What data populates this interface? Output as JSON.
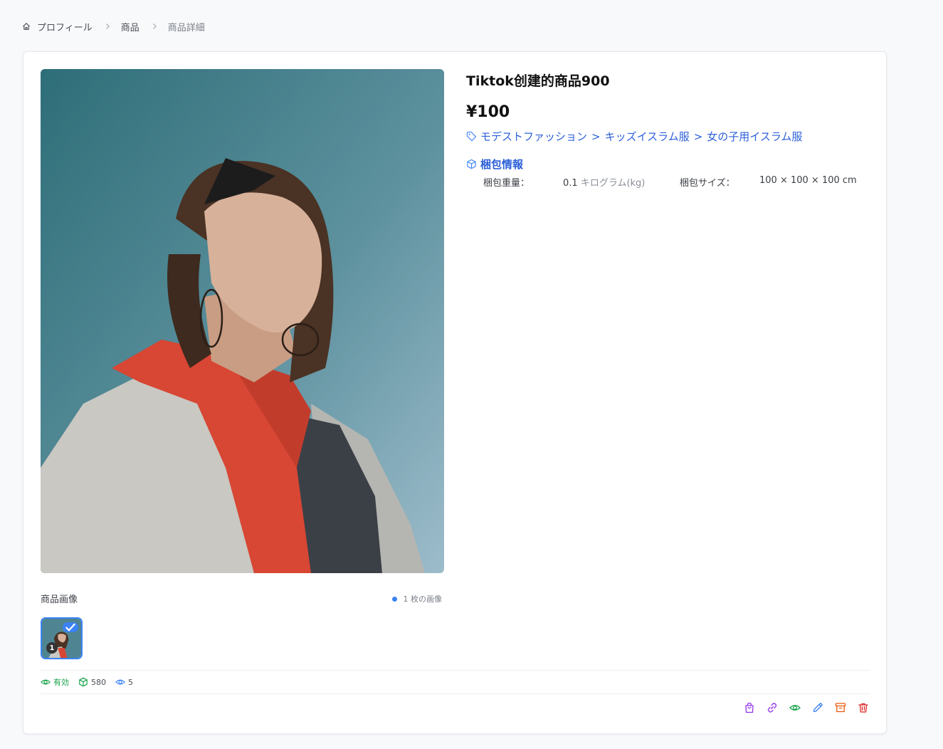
{
  "breadcrumb": {
    "items": [
      "プロフィール",
      "商品",
      "商品詳細"
    ]
  },
  "product": {
    "title": "Tiktok创建的商品900",
    "price": "¥100",
    "category": [
      "モデストファッション",
      "キッズイスラム服",
      "女の子用イスラム服"
    ],
    "category_separator": ">"
  },
  "packaging": {
    "heading": "梱包情報",
    "weight_label": "梱包重量：",
    "weight_value": "0.1",
    "weight_unit": "キログラム(kg)",
    "size_label": "梱包サイズ：",
    "size_value": "100 × 100 × 100 cm"
  },
  "images": {
    "label": "商品画像",
    "count_text": "1 枚の画像",
    "thumbnail_index": "1"
  },
  "stats": {
    "status": "有効",
    "stock": "580",
    "views": "5"
  },
  "actions": [
    "shopping-bag-icon",
    "link-icon",
    "eye-icon",
    "edit-icon",
    "archive-icon",
    "trash-icon"
  ],
  "colors": {
    "accent": "#3b82f6",
    "link": "#2b5fd9",
    "status_green": "#16a34a",
    "purple": "#9333ea",
    "orange": "#ea580c",
    "red": "#dc2626"
  }
}
